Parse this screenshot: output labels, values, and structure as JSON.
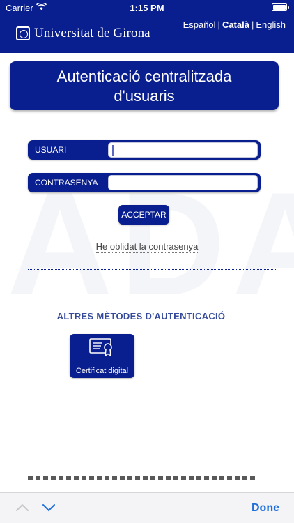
{
  "status_bar": {
    "carrier": "Carrier",
    "time": "1:15 PM"
  },
  "header": {
    "logo_text": "Universitat de Girona",
    "languages": [
      {
        "label": "Español",
        "active": false
      },
      {
        "label": "Català",
        "active": true
      },
      {
        "label": "English",
        "active": false
      }
    ],
    "separator": "|"
  },
  "watermark_text": "ADA",
  "title": {
    "line1": "Autenticació centralitzada",
    "line2": "d'usuaris"
  },
  "login": {
    "user_label": "USUARI",
    "user_value": "",
    "password_label": "CONTRASENYA",
    "password_value": "",
    "accept_label": "ACCEPTAR",
    "forgot_label": "He oblidat la contrasenya"
  },
  "other_methods": {
    "title": "ALTRES MÈTODES D'AUTENTICACIÓ",
    "items": [
      {
        "label": "Certificat digital",
        "icon": "certificate-icon"
      }
    ]
  },
  "toolbar": {
    "done_label": "Done"
  },
  "colors": {
    "brand": "#0a1f8f",
    "accent": "#1e6fd9"
  }
}
